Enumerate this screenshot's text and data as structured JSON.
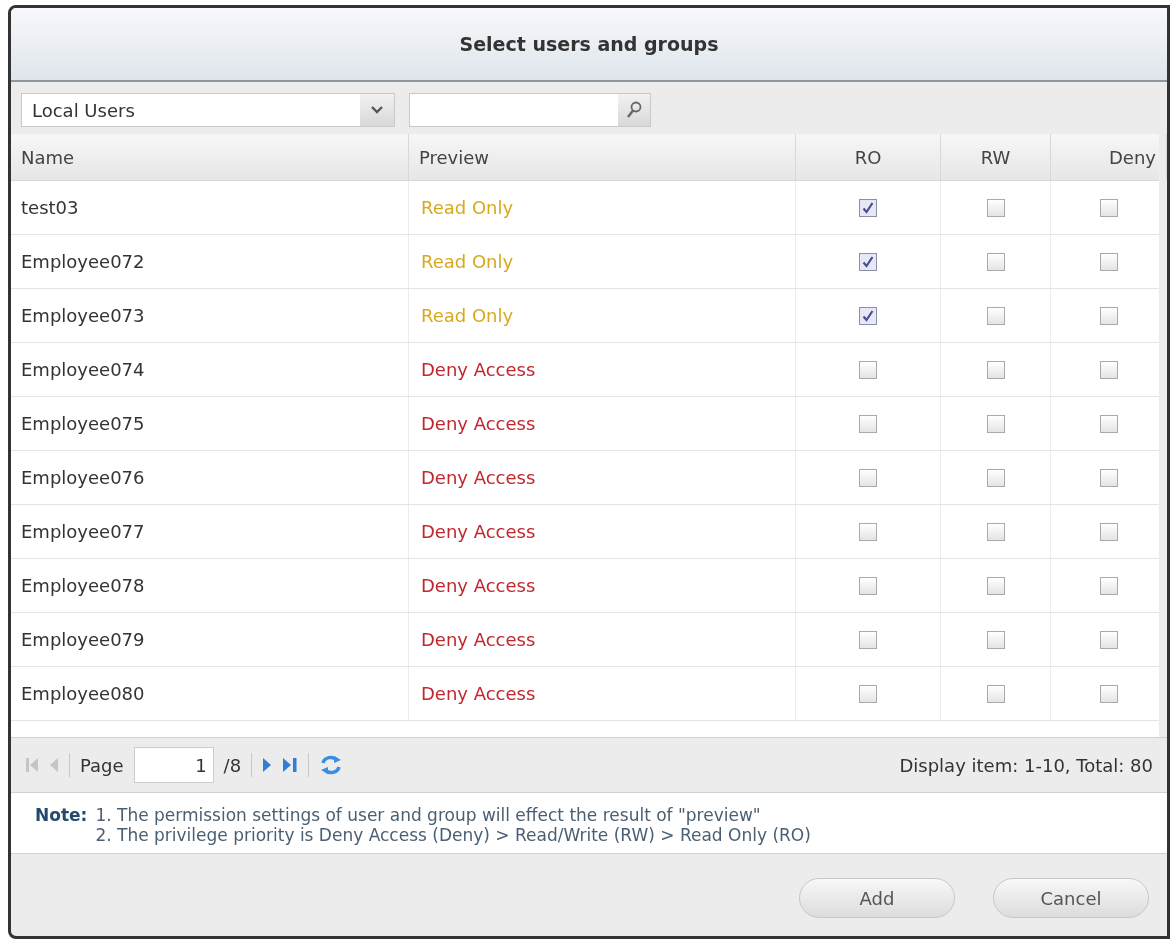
{
  "window": {
    "title": "Select users and groups"
  },
  "toolbar": {
    "filter": "Local Users"
  },
  "table": {
    "columns": [
      "Name",
      "Preview",
      "RO",
      "RW",
      "Deny"
    ],
    "rows": [
      {
        "name": "test03",
        "preview": "Read Only",
        "kind": "read_only",
        "ro": true,
        "rw": false,
        "deny": false
      },
      {
        "name": "Employee072",
        "preview": "Read Only",
        "kind": "read_only",
        "ro": true,
        "rw": false,
        "deny": false
      },
      {
        "name": "Employee073",
        "preview": "Read Only",
        "kind": "read_only",
        "ro": true,
        "rw": false,
        "deny": false
      },
      {
        "name": "Employee074",
        "preview": "Deny Access",
        "kind": "deny",
        "ro": false,
        "rw": false,
        "deny": false
      },
      {
        "name": "Employee075",
        "preview": "Deny Access",
        "kind": "deny",
        "ro": false,
        "rw": false,
        "deny": false
      },
      {
        "name": "Employee076",
        "preview": "Deny Access",
        "kind": "deny",
        "ro": false,
        "rw": false,
        "deny": false
      },
      {
        "name": "Employee077",
        "preview": "Deny Access",
        "kind": "deny",
        "ro": false,
        "rw": false,
        "deny": false
      },
      {
        "name": "Employee078",
        "preview": "Deny Access",
        "kind": "deny",
        "ro": false,
        "rw": false,
        "deny": false
      },
      {
        "name": "Employee079",
        "preview": "Deny Access",
        "kind": "deny",
        "ro": false,
        "rw": false,
        "deny": false
      },
      {
        "name": "Employee080",
        "preview": "Deny Access",
        "kind": "deny",
        "ro": false,
        "rw": false,
        "deny": false
      }
    ]
  },
  "pager": {
    "page_label": "Page",
    "page": "1",
    "total_pages": "/8",
    "summary": "Display item: 1-10, Total: 80"
  },
  "note": {
    "label": "Note:",
    "lines": [
      "1. The permission settings of user and group will effect the result of \"preview\"",
      "2. The privilege priority is Deny Access (Deny) > Read/Write (RW) > Read Only (RO)"
    ]
  },
  "buttons": [
    "Add",
    "Cancel"
  ]
}
